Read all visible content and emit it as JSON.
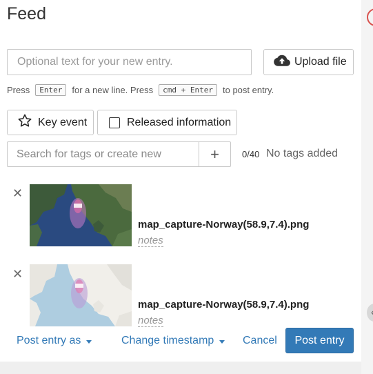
{
  "feed": {
    "title": "Feed",
    "entry_placeholder": "Optional text for your new entry.",
    "upload_label": "Upload file",
    "hint": {
      "press": "Press",
      "enter_key": "Enter",
      "new_line_text": "for a new line. Press",
      "post_key": "cmd + Enter",
      "post_text": "to post entry."
    },
    "key_event_label": "Key event",
    "released_label": "Released information",
    "tag_placeholder": "Search for tags or create new",
    "tag_add_symbol": "+",
    "tag_count": "0/40",
    "tags_empty": "No tags added",
    "attachments": [
      {
        "name": "map_capture-Norway(58.9,7.4).png",
        "notes": "notes",
        "style": "satellite"
      },
      {
        "name": "map_capture-Norway(58.9,7.4).png",
        "notes": "notes",
        "style": "street"
      }
    ],
    "footer": {
      "post_as": "Post entry as",
      "change_timestamp": "Change timestamp",
      "cancel": "Cancel",
      "post": "Post entry"
    }
  },
  "colors": {
    "primary": "#337ab7",
    "alert_ring": "#d9534f"
  },
  "icons": {
    "upload": "cloud-upload-icon",
    "key_event": "star-outline-icon",
    "remove": "close-icon",
    "dropdown": "caret-down-icon"
  }
}
